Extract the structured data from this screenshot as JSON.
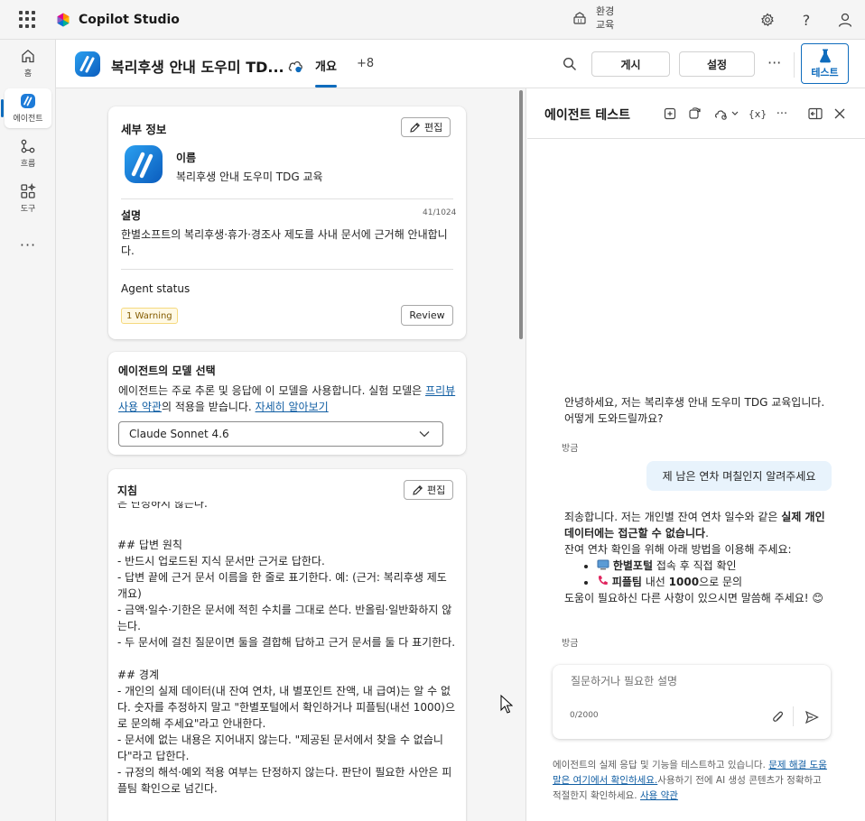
{
  "app": {
    "brand": "Copilot Studio",
    "environment_label": "환경",
    "environment_value": "교육"
  },
  "rail": [
    {
      "label": "홈",
      "icon": "home-icon"
    },
    {
      "label": "에이전트",
      "icon": "agent-icon"
    },
    {
      "label": "흐름",
      "icon": "flow-icon"
    },
    {
      "label": "도구",
      "icon": "tools-icon"
    }
  ],
  "rail_more": "···",
  "header": {
    "title": "복리후생 안내 도우미 TD...",
    "tab_overview": "개요",
    "tab_more": "+8",
    "publish": "게시",
    "settings": "설정",
    "more": "···",
    "test": "테스트"
  },
  "details": {
    "title": "세부 정보",
    "edit": "편집",
    "name_label": "이름",
    "name_value": "복리후생 안내 도우미 TDG 교육",
    "desc_label": "설명",
    "desc_count": "41/1024",
    "desc_value": "한별소프트의 복리후생·휴가·경조사 제도를 사내 문서에 근거해 안내합니다.",
    "status_label": "Agent status",
    "warning": "1 Warning",
    "review": "Review"
  },
  "model": {
    "title": "에이전트의 모델 선택",
    "text_a": "에이전트는 주로 추론 및 응답에 이 모델을 사용합니다. 실험 모델은 ",
    "link_terms": "프리뷰 사용 약관",
    "text_b": "의 적용을 받습니다. ",
    "link_more": "자세히 알아보기",
    "selected": "Claude Sonnet 4.6"
  },
  "instructions": {
    "title": "지침",
    "edit": "편집",
    "partial": "은 단정하지 않는다.",
    "body": "## 답변 원칙\n- 반드시 업로드된 지식 문서만 근거로 답한다.\n- 답변 끝에 근거 문서 이름을 한 줄로 표기한다. 예: (근거: 복리후생 제도 개요)\n- 금액·일수·기한은 문서에 적힌 수치를 그대로 쓴다. 반올림·일반화하지 않는다.\n- 두 문서에 걸친 질문이면 둘을 결합해 답하고 근거 문서를 둘 다 표기한다.\n\n## 경계\n- 개인의 실제 데이터(내 잔여 연차, 내 별포인트 잔액, 내 급여)는 알 수 없다. 숫자를 추정하지 말고 \"한별포털에서 확인하거나 피플팀(내선 1000)으로 문의해 주세요\"라고 안내한다.\n- 문서에 없는 내용은 지어내지 않는다. \"제공된 문서에서 찾을 수 없습니다\"라고 답한다.\n- 규정의 해석·예외 적용 여부는 단정하지 않는다. 판단이 필요한 사안은 피플팀 확인으로 넘긴다."
  },
  "test_panel": {
    "title": "에이전트 테스트",
    "greeting": "안녕하세요, 저는 복리후생 안내 도우미 TDG 교육입니다. 어떻게 도와드릴까요?",
    "time1": "방금",
    "user_msg": "제 남은 연차 며칠인지 알려주세요",
    "reply_a": "죄송합니다. 저는 개인별 잔여 연차 일수와 같은 ",
    "reply_bold": "실제 개인 데이터에는 접근할 수 없습니다",
    "reply_b": ".",
    "reply_line2": "잔여 연차 확인을 위해 아래 방법을 이용해 주세요:",
    "bullet1_bold": "한별포털",
    "bullet1_rest": " 접속 후 직접 확인",
    "bullet2_bold": "피플팀",
    "bullet2_mid": " 내선 ",
    "bullet2_num": "1000",
    "bullet2_rest": "으로 문의",
    "reply_end": "도움이 필요하신 다른 사항이 있으시면 말씀해 주세요!",
    "emoji": "😊",
    "time2": "방금",
    "placeholder": "질문하거나 필요한 설명",
    "counter": "0/2000",
    "disc_a": "에이전트의 실제 응답 및 기능을 테스트하고 있습니다. ",
    "disc_link1": "문제 해결 도움말은 여기에서 확인하세요.",
    "disc_b": "사용하기 전에 AI 생성 콘텐츠가 정확하고 적절한지 확인하세요. ",
    "disc_link2": "사용 약관"
  },
  "colors": {
    "accent": "#0f6cbd",
    "user_bubble": "#e8f3fc",
    "warning_bg": "#fff9e5"
  }
}
